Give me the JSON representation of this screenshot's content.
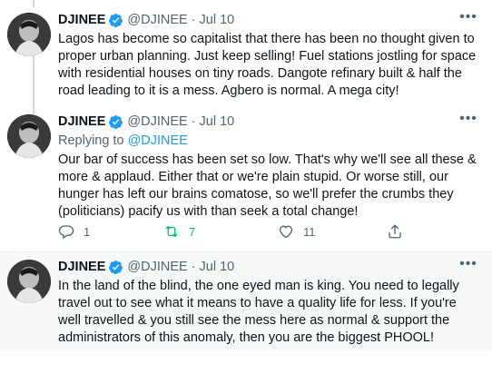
{
  "colors": {
    "text": "#0f1419",
    "secondary": "#536471",
    "accent": "#1d9bf0",
    "retweet_active": "#00ba7c",
    "thread_line": "#cfd9de",
    "highlight_bg": "#f7f9f9"
  },
  "tweets": [
    {
      "name": "DJINEE",
      "handle": "@DJINEE",
      "separator": "·",
      "date": "Jul 10",
      "more": "•••",
      "text": "Lagos has become so capitalist that there has been no thought given to proper urban planning. Just keep selling! Fuel stations jostling for space with residential houses on tiny roads. Dangote refinary built & half the road leading to it is a mess. Agbero is normal. A mega city!"
    },
    {
      "name": "DJINEE",
      "handle": "@DJINEE",
      "separator": "·",
      "date": "Jul 10",
      "more": "•••",
      "replying_prefix": "Replying to",
      "replying_to": "@DJINEE",
      "text": "Our bar of success has been set so low. That's why we'll see all these & more & applaud. Either that or we're plain stupid. Or worse still, our hunger has left our brains comatose, so we'll prefer the crumbs they (politicians) pacify us with than seek a total change!",
      "actions": {
        "reply_count": "1",
        "retweet_count": "7",
        "like_count": "11"
      }
    },
    {
      "name": "DJINEE",
      "handle": "@DJINEE",
      "separator": "·",
      "date": "Jul 10",
      "more": "•••",
      "text": "In the land of the blind, the one eyed man is king. You need to legally travel out to see what it means to have a quality life for less. If you're well travelled & you still see the mess here as normal & support the administrators of this anomaly, then you are the biggest PHOOL!"
    }
  ],
  "icons": {
    "verified": "verified-badge-icon",
    "reply": "reply-icon",
    "retweet": "retweet-icon",
    "like": "like-icon",
    "share": "share-icon",
    "more": "more-icon"
  }
}
